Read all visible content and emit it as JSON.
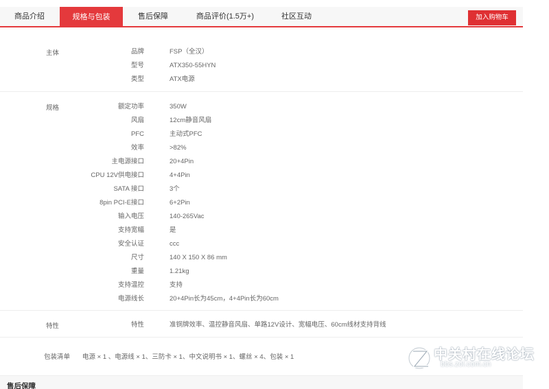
{
  "tabs": [
    {
      "label": "商品介绍",
      "active": false
    },
    {
      "label": "规格与包装",
      "active": true
    },
    {
      "label": "售后保障",
      "active": false
    },
    {
      "label": "商品评价(1.5万+)",
      "active": false
    },
    {
      "label": "社区互动",
      "active": false
    }
  ],
  "cart_button": "加入购物车",
  "spec_groups": [
    {
      "title": "主体",
      "rows": [
        {
          "key": "品牌",
          "value": "FSP（全汉）"
        },
        {
          "key": "型号",
          "value": "ATX350-55HYN"
        },
        {
          "key": "类型",
          "value": "ATX电源"
        }
      ]
    },
    {
      "title": "规格",
      "rows": [
        {
          "key": "额定功率",
          "value": "350W"
        },
        {
          "key": "风扇",
          "value": "12cm静音风扇"
        },
        {
          "key": "PFC",
          "value": "主动式PFC"
        },
        {
          "key": "效率",
          "value": ">82%"
        },
        {
          "key": "主电源接口",
          "value": "20+4Pin"
        },
        {
          "key": "CPU 12V供电接口",
          "value": "4+4Pin"
        },
        {
          "key": "SATA 接口",
          "value": "3个"
        },
        {
          "key": "8pin PCI-E接口",
          "value": "6+2Pin"
        },
        {
          "key": "输入电压",
          "value": "140-265Vac"
        },
        {
          "key": "支持宽幅",
          "value": "是"
        },
        {
          "key": "安全认证",
          "value": "ccc"
        },
        {
          "key": "尺寸",
          "value": "140 X 150 X 86 mm"
        },
        {
          "key": "重量",
          "value": "1.21kg"
        },
        {
          "key": "支持温控",
          "value": "支持"
        },
        {
          "key": "电源线长",
          "value": "20+4Pin长为45cm，4+4Pin长为60cm"
        }
      ]
    },
    {
      "title": "特性",
      "rows": [
        {
          "key": "特性",
          "value": "准铜牌效率、温控静音风扇、单路12V设计、宽幅电压、60cm线材支持背线"
        }
      ]
    }
  ],
  "packing": {
    "label": "包装清单",
    "value": "电源 × 1 、电源线 × 1、三防卡 × 1、中文说明书 × 1、螺丝 × 4、包装 × 1"
  },
  "after_sales_heading": "售后保障",
  "watermark": {
    "title": "中关村在线论坛",
    "url": "bbs.zol.com.cn",
    "logo_icon": "zol-logo-icon"
  },
  "colors": {
    "accent": "#e4393c",
    "tab_bg": "#f7f7f7",
    "divider": "#eeeeee",
    "text": "#666666"
  }
}
